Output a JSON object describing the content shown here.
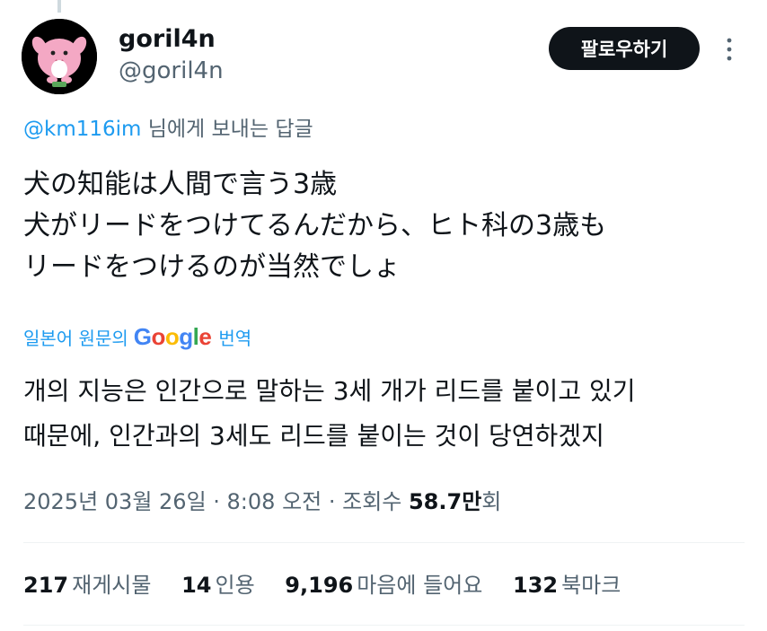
{
  "author": {
    "display_name": "goril4n",
    "handle": "@goril4n",
    "avatar_icon": "pink-creature-avatar"
  },
  "actions": {
    "follow_label": "팔로우하기",
    "more_icon": "more-vertical-icon"
  },
  "reply": {
    "mention": "@km116im",
    "suffix": " 님에게 보내는 답글"
  },
  "tweet": {
    "lines": [
      "犬の知能は人間で言う3歳",
      "犬がリードをつけてるんだから、ヒト科の3歳も",
      "リードをつけるのが当然でしょ"
    ]
  },
  "translation": {
    "prefix": "일본어 원문의",
    "logo_text": "Google",
    "action": "번역",
    "lines": [
      "개의 지능은 인간으로 말하는 3세 개가 리드를 붙이고 있기",
      "때문에, 인간과의 3세도 리드를 붙이는 것이 당연하겠지"
    ]
  },
  "meta": {
    "timestamp": "2025년 03월 26일 · 8:08 오전 · 조회수 ",
    "views": "58.7만",
    "views_suffix": "회"
  },
  "stats": [
    {
      "count": "217",
      "label": "재게시물"
    },
    {
      "count": "14",
      "label": "인용"
    },
    {
      "count": "9,196",
      "label": "마음에 들어요"
    },
    {
      "count": "132",
      "label": "북마크"
    }
  ],
  "colors": {
    "accent": "#1d9bf0",
    "text": "#0f1419",
    "secondary": "#536471",
    "avatar_pink": "#f4a8c4"
  }
}
